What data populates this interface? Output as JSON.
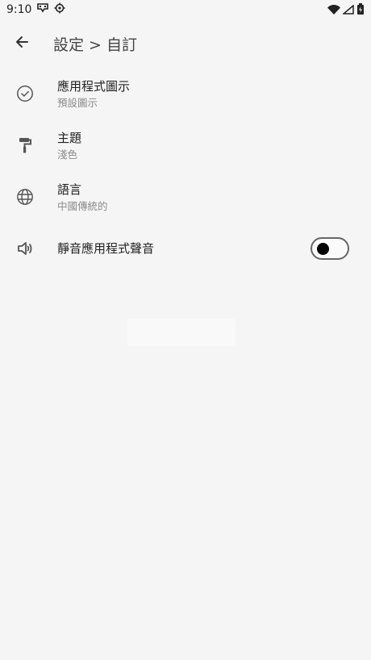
{
  "status": {
    "time": "9:10",
    "icons": [
      "game-controller-icon",
      "gear-icon",
      "wifi-icon",
      "cellular-icon",
      "battery-icon"
    ]
  },
  "header": {
    "title": "設定 > 自訂",
    "back_icon": "arrow-back-icon"
  },
  "settings": {
    "items": [
      {
        "label": "應用程式圖示",
        "value": "預設圖示",
        "icon": "check-circle-icon"
      },
      {
        "label": "主題",
        "value": "淺色",
        "icon": "paint-roller-icon"
      },
      {
        "label": "語言",
        "value": "中國傳統的",
        "icon": "globe-icon"
      }
    ],
    "mute": {
      "label": "靜音應用程式聲音",
      "icon": "speaker-icon",
      "on": false
    }
  },
  "colors": {
    "background": "#f5f5f5",
    "text_primary": "#1f1f1f",
    "text_secondary": "#8a8a8a"
  }
}
